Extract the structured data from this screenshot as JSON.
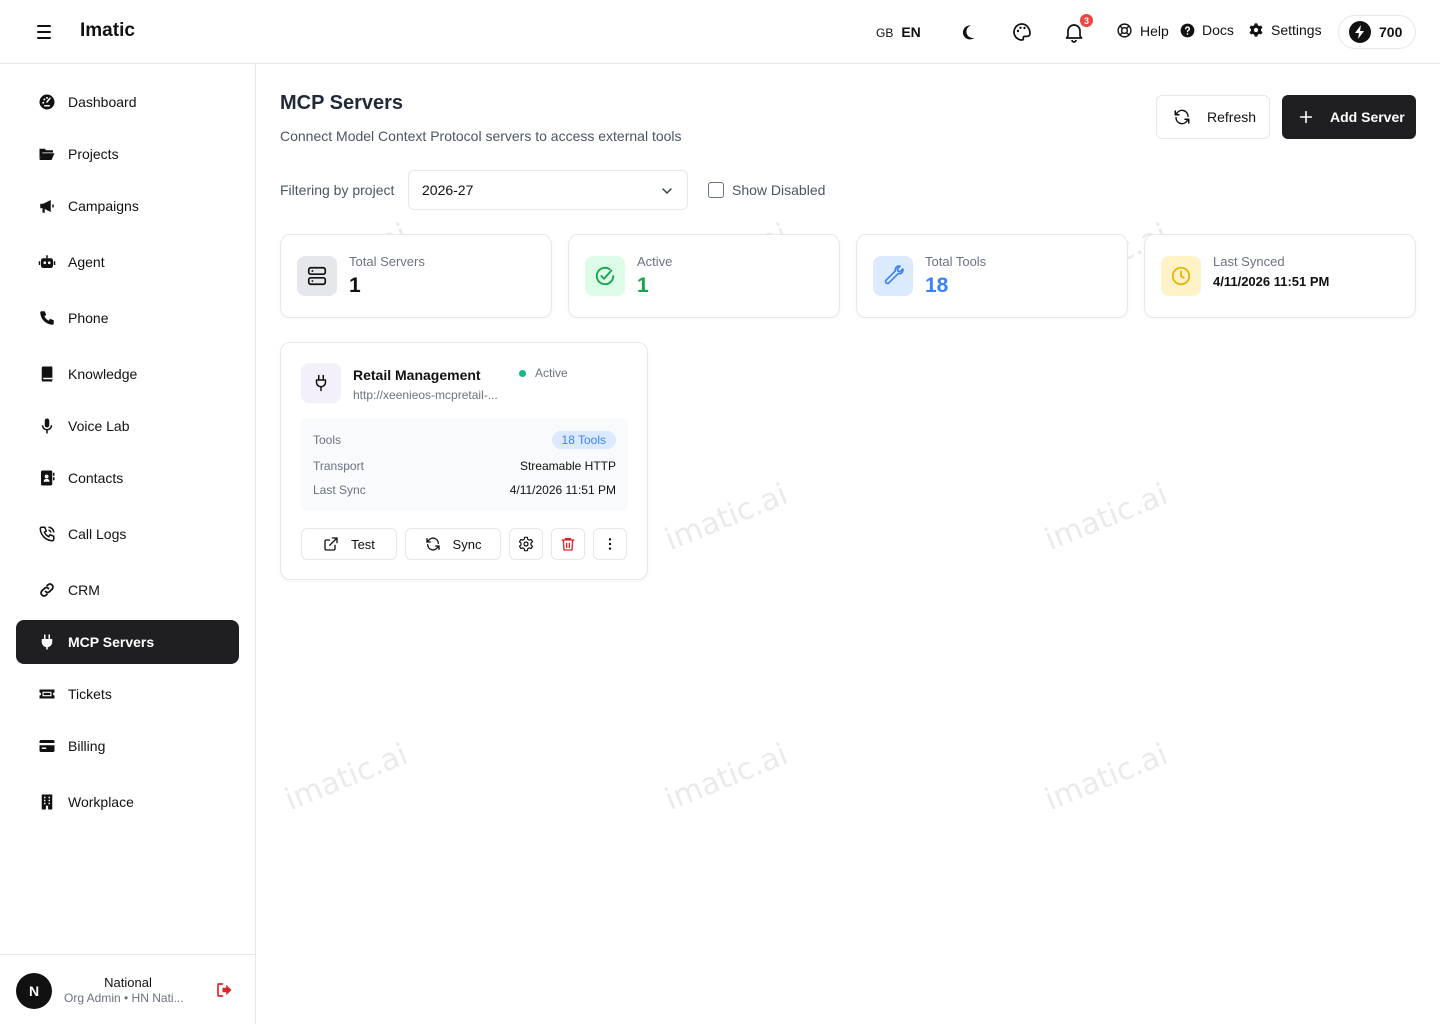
{
  "header": {
    "app_title": "Imatic",
    "lang_flag": "GB",
    "lang_code": "EN",
    "notifications_count": "3",
    "help_label": "Help",
    "docs_label": "Docs",
    "settings_label": "Settings",
    "credits": "700"
  },
  "sidebar": {
    "items": [
      {
        "label": "Dashboard",
        "icon": "dashboard-icon"
      },
      {
        "label": "Projects",
        "icon": "folder-icon"
      },
      {
        "label": "Campaigns",
        "icon": "megaphone-icon"
      },
      {
        "label": "Agent",
        "icon": "robot-icon"
      },
      {
        "label": "Phone",
        "icon": "phone-icon"
      },
      {
        "label": "Knowledge",
        "icon": "book-icon"
      },
      {
        "label": "Voice Lab",
        "icon": "microphone-icon"
      },
      {
        "label": "Contacts",
        "icon": "contact-book-icon"
      },
      {
        "label": "Call Logs",
        "icon": "phone-call-icon"
      },
      {
        "label": "CRM",
        "icon": "link-icon"
      },
      {
        "label": "MCP Servers",
        "icon": "plug-icon"
      },
      {
        "label": "Tickets",
        "icon": "ticket-icon"
      },
      {
        "label": "Billing",
        "icon": "credit-card-icon"
      },
      {
        "label": "Workplace",
        "icon": "building-icon"
      }
    ],
    "active_item": "MCP Servers",
    "user": {
      "initial": "N",
      "name": "National",
      "role": "Org Admin • HN Nati..."
    }
  },
  "main": {
    "title": "MCP Servers",
    "subtitle": "Connect Model Context Protocol servers to access external tools",
    "refresh_label": "Refresh",
    "add_label": "Add Server",
    "filter_label": "Filtering by project",
    "filter_value": "2026-27",
    "show_disabled_label": "Show Disabled",
    "show_disabled_checked": false
  },
  "stats": [
    {
      "label": "Total Servers",
      "value": "1",
      "color": "#111111",
      "icon": "server-icon"
    },
    {
      "label": "Active",
      "value": "1",
      "color": "#16a34a",
      "icon": "check-circle-icon"
    },
    {
      "label": "Total Tools",
      "value": "18",
      "color": "#3b82f6",
      "icon": "wrench-icon"
    },
    {
      "label": "Last Synced",
      "value": "4/11/2026 11:51 PM",
      "color": "#111111",
      "icon": "clock-icon"
    }
  ],
  "server_card": {
    "name": "Retail Management",
    "url": "http://xeenieos-mcpretail-...",
    "status": "Active",
    "tools_label": "Tools",
    "tools_value": "18 Tools",
    "transport_label": "Transport",
    "transport_value": "Streamable HTTP",
    "last_sync_label": "Last Sync",
    "last_sync_value": "4/11/2026 11:51 PM",
    "test_label": "Test",
    "sync_label": "Sync"
  },
  "watermark": "imatic.ai"
}
